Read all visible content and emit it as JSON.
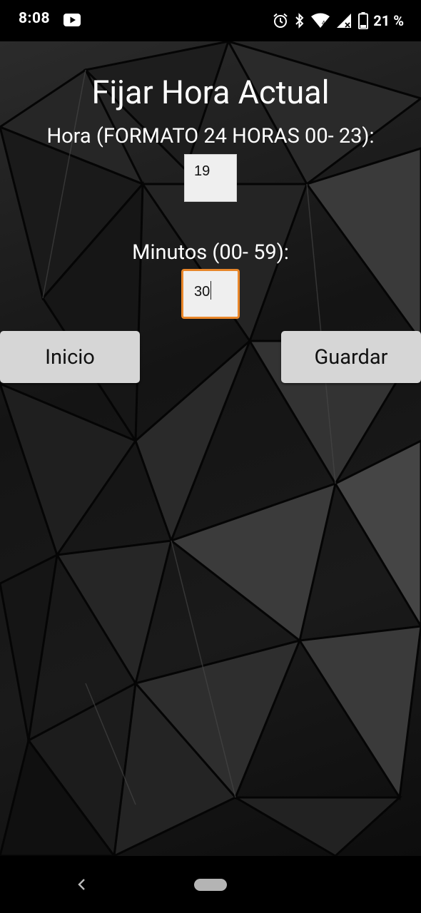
{
  "status_bar": {
    "time": "8:08",
    "battery": "21 %",
    "icons": [
      "youtube-icon",
      "alarm-icon",
      "bluetooth-icon",
      "wifi-icon",
      "signal-icon",
      "battery-icon"
    ]
  },
  "screen": {
    "title": "Fijar Hora Actual",
    "hour_label": "Hora (FORMATO 24 HORAS 00- 23):",
    "hour_value": "19",
    "minutes_label": "Minutos (00- 59):",
    "minutes_value": "30"
  },
  "buttons": {
    "home_label": "Inicio",
    "save_label": "Guardar"
  },
  "navigation": {
    "icons": [
      "back-icon",
      "home-pill"
    ]
  },
  "colors": {
    "accent_focus": "#e8862a",
    "button_bg": "#d6d6d6",
    "field_bg": "#efefef",
    "text_light": "#ffffff"
  }
}
